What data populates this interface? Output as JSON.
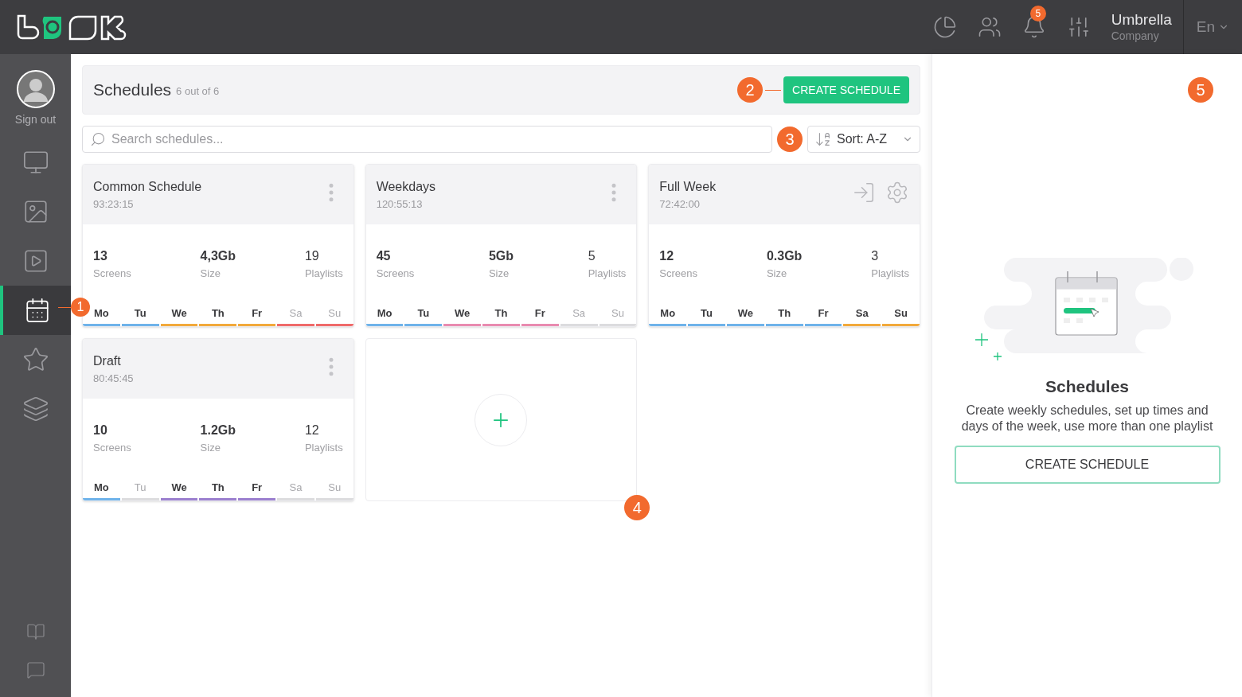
{
  "topbar": {
    "notifications": "5",
    "account": {
      "name": "Umbrella",
      "company": "Company"
    },
    "language": "En"
  },
  "sidebar": {
    "sign_out": "Sign out",
    "items": [
      {
        "kind": "screens",
        "selected": false
      },
      {
        "kind": "images",
        "selected": false
      },
      {
        "kind": "playlists",
        "selected": false
      },
      {
        "kind": "schedules",
        "selected": true
      },
      {
        "kind": "star",
        "selected": false
      },
      {
        "kind": "layers",
        "selected": false
      }
    ],
    "bottom_items": [
      {
        "kind": "book",
        "selected": false
      },
      {
        "kind": "chat",
        "selected": false
      }
    ]
  },
  "header": {
    "title": "Schedules",
    "count": "6 out of 6",
    "button": "CREATE SCHEDULE"
  },
  "search": {
    "placeholder": "Search schedules..."
  },
  "sort": {
    "label": "Sort: A-Z"
  },
  "cards": [
    {
      "name": "Common Schedule",
      "duration": "93:23:15",
      "hovered": false,
      "stats": [
        {
          "value": "13",
          "label": "Screens"
        },
        {
          "value": "4,3Gb",
          "label": "Size"
        },
        {
          "value": "19",
          "label": "Playlists"
        }
      ],
      "days": [
        {
          "label": "Mo",
          "active": true,
          "color": "#6fb3ea"
        },
        {
          "label": "Tu",
          "active": true,
          "color": "#6fb3ea"
        },
        {
          "label": "We",
          "active": true,
          "color": "#f2a93b"
        },
        {
          "label": "Th",
          "active": true,
          "color": "#f2a93b"
        },
        {
          "label": "Fr",
          "active": true,
          "color": "#f2a93b"
        },
        {
          "label": "Sa",
          "active": false,
          "color": "#ef6a6a"
        },
        {
          "label": "Su",
          "active": false,
          "color": "#ef6a6a"
        }
      ]
    },
    {
      "name": "Weekdays",
      "duration": "120:55:13",
      "hovered": false,
      "stats": [
        {
          "value": "45",
          "label": "Screens"
        },
        {
          "value": "5Gb",
          "label": "Size"
        },
        {
          "value": "5",
          "label": "Playlists"
        }
      ],
      "days": [
        {
          "label": "Mo",
          "active": true,
          "color": "#6fb3ea"
        },
        {
          "label": "Tu",
          "active": true,
          "color": "#6fb3ea"
        },
        {
          "label": "We",
          "active": true,
          "color": "#e98bb0"
        },
        {
          "label": "Th",
          "active": true,
          "color": "#e98bb0"
        },
        {
          "label": "Fr",
          "active": true,
          "color": "#e98bb0"
        },
        {
          "label": "Sa",
          "active": false,
          "color": "#dcdcde"
        },
        {
          "label": "Su",
          "active": false,
          "color": "#dcdcde"
        }
      ]
    },
    {
      "name": "Full Week",
      "duration": "72:42:00",
      "hovered": true,
      "stats": [
        {
          "value": "12",
          "label": "Screens"
        },
        {
          "value": "0.3Gb",
          "label": "Size"
        },
        {
          "value": "3",
          "label": "Playlists"
        }
      ],
      "days": [
        {
          "label": "Mo",
          "active": true,
          "color": "#6fb3ea"
        },
        {
          "label": "Tu",
          "active": true,
          "color": "#6fb3ea"
        },
        {
          "label": "We",
          "active": true,
          "color": "#6fb3ea"
        },
        {
          "label": "Th",
          "active": true,
          "color": "#6fb3ea"
        },
        {
          "label": "Fr",
          "active": true,
          "color": "#6fb3ea"
        },
        {
          "label": "Sa",
          "active": true,
          "color": "#f2a93b"
        },
        {
          "label": "Su",
          "active": true,
          "color": "#f2a93b"
        }
      ]
    },
    {
      "name": "Draft",
      "duration": "80:45:45",
      "hovered": false,
      "stats": [
        {
          "value": "10",
          "label": "Screens"
        },
        {
          "value": "1.2Gb",
          "label": "Size"
        },
        {
          "value": "12",
          "label": "Playlists"
        }
      ],
      "days": [
        {
          "label": "Mo",
          "active": true,
          "color": "#6fb3ea"
        },
        {
          "label": "Tu",
          "active": false,
          "color": "#dcdcde"
        },
        {
          "label": "We",
          "active": true,
          "color": "#9b7fcf"
        },
        {
          "label": "Th",
          "active": true,
          "color": "#9b7fcf"
        },
        {
          "label": "Fr",
          "active": true,
          "color": "#9b7fcf"
        },
        {
          "label": "Sa",
          "active": false,
          "color": "#dcdcde"
        },
        {
          "label": "Su",
          "active": false,
          "color": "#dcdcde"
        }
      ]
    }
  ],
  "info_panel": {
    "title": "Schedules",
    "description": "Create weekly schedules, set up times and days of the week, use more than one playlist",
    "button": "CREATE SCHEDULE"
  },
  "callouts": [
    "1",
    "2",
    "3",
    "4",
    "5"
  ]
}
